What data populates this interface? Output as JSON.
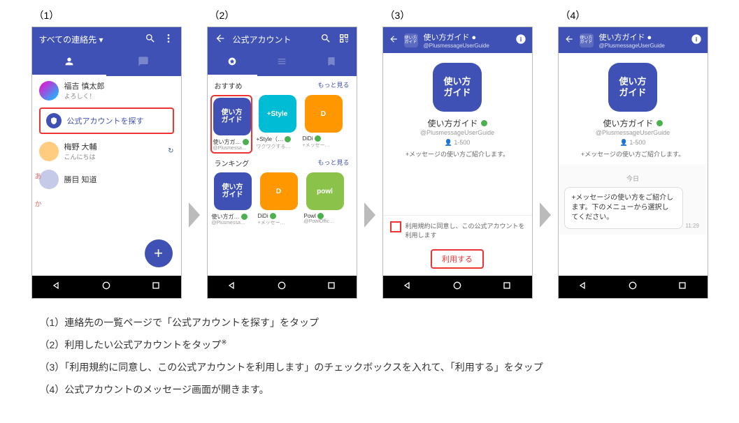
{
  "labels": {
    "s1": "（1）",
    "s2": "（2）",
    "s3": "（3）",
    "s4": "（4）"
  },
  "screen1": {
    "title": "すべての連絡先 ▾",
    "contacts": [
      {
        "name": "福吉 慎太郎",
        "sub": "よろしく！"
      },
      {
        "name": "梅野 大輔",
        "sub": "こんにちは"
      },
      {
        "name": "勝目 知道",
        "sub": ""
      }
    ],
    "find_label": "公式アカウントを探す",
    "letters": [
      "あ",
      "か"
    ]
  },
  "screen2": {
    "title": "公式アカウント",
    "section1": "おすすめ",
    "section2": "ランキング",
    "more": "もっと見る",
    "cards1": [
      {
        "thumb": "使い方\nガイド",
        "cls": "blue",
        "t1": "使い方ガ…",
        "t2": "@Plusmessa…"
      },
      {
        "thumb": "+Style",
        "cls": "teal",
        "t1": "+Style（…",
        "t2": "ワクワクする…"
      },
      {
        "thumb": "D",
        "cls": "orange",
        "t1": "DiDi",
        "t2": "+メッセー…"
      }
    ],
    "cards2": [
      {
        "thumb": "使い方\nガイド",
        "cls": "blue",
        "t1": "使い方ガ…",
        "t2": "@Plusmessa…"
      },
      {
        "thumb": "D",
        "cls": "orange",
        "t1": "DiDi",
        "t2": "+メッセー…"
      },
      {
        "thumb": "powl",
        "cls": "green",
        "t1": "Powl",
        "t2": "@PowlOffic…"
      }
    ]
  },
  "screen3": {
    "head_title": "使い方ガイド ●",
    "head_sub": "@PlusmessageUserGuide",
    "logo_text": "使い方\nガイド",
    "profile_name": "使い方ガイド",
    "profile_id": "@PlusmessageUserGuide",
    "profile_count": "1-500",
    "profile_desc": "+メッセージの使い方ご紹介します。",
    "agree_text": "利用規約に同意し、この公式アカウントを利用します",
    "use_btn": "利用する"
  },
  "screen4": {
    "head_title": "使い方ガイド ●",
    "head_sub": "@PlusmessageUserGuide",
    "logo_text": "使い方\nガイド",
    "profile_name": "使い方ガイド",
    "profile_id": "@PlusmessageUserGuide",
    "profile_count": "1-500",
    "profile_desc": "+メッセージの使い方ご紹介します。",
    "day": "今日",
    "msg": "+メッセージの使い方をご紹介します。下のメニューから選択してください。",
    "time": "11:29"
  },
  "captions": {
    "c1": "（1）連絡先の一覧ページで「公式アカウントを探す」をタップ",
    "c2": "（2）利用したい公式アカウントをタップ",
    "c2_note": "※",
    "c3": "（3）「利用規約に同意し、この公式アカウントを利用します」のチェックボックスを入れて、「利用する」をタップ",
    "c4": "（4）公式アカウントのメッセージ画面が開きます。"
  }
}
